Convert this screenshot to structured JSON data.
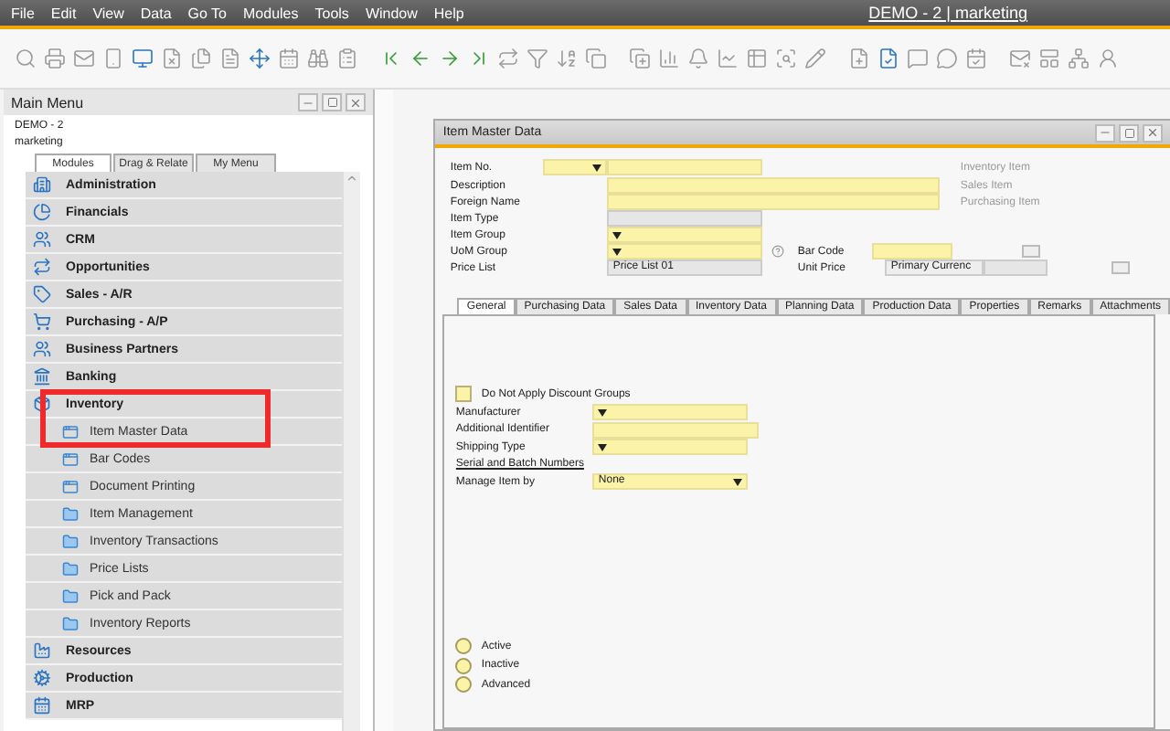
{
  "menu_bar": {
    "items": [
      "File",
      "Edit",
      "View",
      "Data",
      "Go To",
      "Modules",
      "Tools",
      "Window",
      "Help"
    ],
    "title": "DEMO - 2 | marketing"
  },
  "main_menu": {
    "title": "Main Menu",
    "company": "DEMO - 2",
    "user": "marketing",
    "tabs": [
      {
        "label": "Modules",
        "selected": true
      },
      {
        "label": "Drag & Relate",
        "selected": false
      },
      {
        "label": "My Menu",
        "selected": false
      }
    ],
    "modules": [
      {
        "label": "Administration"
      },
      {
        "label": "Financials"
      },
      {
        "label": "CRM"
      },
      {
        "label": "Opportunities"
      },
      {
        "label": "Sales - A/R"
      },
      {
        "label": "Purchasing - A/P"
      },
      {
        "label": "Business Partners"
      },
      {
        "label": "Banking"
      },
      {
        "label": "Inventory",
        "children": [
          {
            "label": "Item Master Data",
            "kind": "form"
          },
          {
            "label": "Bar Codes",
            "kind": "form"
          },
          {
            "label": "Document Printing",
            "kind": "form"
          },
          {
            "label": "Item Management",
            "kind": "folder"
          },
          {
            "label": "Inventory Transactions",
            "kind": "folder"
          },
          {
            "label": "Price Lists",
            "kind": "folder"
          },
          {
            "label": "Pick and Pack",
            "kind": "folder"
          },
          {
            "label": "Inventory Reports",
            "kind": "folder"
          }
        ]
      },
      {
        "label": "Resources"
      },
      {
        "label": "Production"
      },
      {
        "label": "MRP"
      }
    ]
  },
  "item_master": {
    "title": "Item Master Data",
    "header_rows": [
      {
        "label": "Item No.",
        "kind": "code"
      },
      {
        "label": "Description",
        "kind": "text"
      },
      {
        "label": "Foreign Name",
        "kind": "text"
      },
      {
        "label": "Item Type",
        "kind": "readonly"
      },
      {
        "label": "Item Group",
        "kind": "select"
      },
      {
        "label": "UoM Group",
        "kind": "select"
      },
      {
        "label": "Price List",
        "kind": "readonly",
        "value": "Price List 01"
      }
    ],
    "item_flags": [
      {
        "label": "Inventory Item",
        "disabled": true
      },
      {
        "label": "Sales Item",
        "disabled": true
      },
      {
        "label": "Purchasing Item",
        "disabled": true
      }
    ],
    "bar_code": {
      "label": "Bar Code"
    },
    "unit_price": {
      "label": "Unit Price",
      "value": "Primary Currenc"
    },
    "tabs": [
      {
        "label": "General",
        "selected": true
      },
      {
        "label": "Purchasing Data",
        "selected": false
      },
      {
        "label": "Sales Data",
        "selected": false
      },
      {
        "label": "Inventory Data",
        "selected": false
      },
      {
        "label": "Planning Data",
        "selected": false
      },
      {
        "label": "Production Data",
        "selected": false
      },
      {
        "label": "Properties",
        "selected": false
      },
      {
        "label": "Remarks",
        "selected": false
      },
      {
        "label": "Attachments",
        "selected": false
      }
    ],
    "discount_groups": {
      "label": "Do Not Apply Discount Groups",
      "checked": false
    },
    "general_rows": [
      {
        "label": "Manufacturer",
        "kind": "select"
      },
      {
        "label": "Additional Identifier",
        "kind": "text"
      },
      {
        "label": "Shipping Type",
        "kind": "select"
      },
      {
        "label": "Serial and Batch Numbers",
        "kind": "section"
      },
      {
        "label": "Manage Item by",
        "kind": "select",
        "value": "None"
      }
    ],
    "status": [
      {
        "label": "Active",
        "selected": false
      },
      {
        "label": "Inactive",
        "selected": false
      },
      {
        "label": "Advanced",
        "selected": false
      }
    ]
  }
}
